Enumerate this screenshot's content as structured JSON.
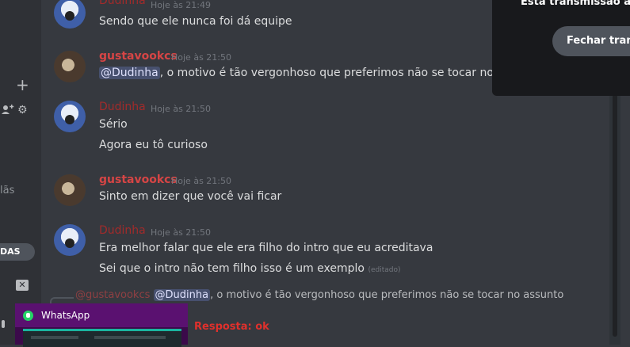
{
  "sidebar": {
    "partial_label": "lãs",
    "pill_label": "DAS"
  },
  "messages": [
    {
      "user": "Dudinha",
      "time": "Hoje às 21:49",
      "lines": [
        "Sendo que ele nunca foi dá equipe"
      ]
    },
    {
      "user": "gustavookcs",
      "time": "Hoje às 21:50",
      "mention": "@Dudinha",
      "lines": [
        ", o motivo é tão vergonhoso que preferimos não se tocar no assunto"
      ]
    },
    {
      "user": "Dudinha",
      "time": "Hoje às 21:50",
      "lines": [
        "Sério",
        "Agora eu tô curioso"
      ]
    },
    {
      "user": "gustavookcs",
      "time": "Hoje às 21:50",
      "lines": [
        "Sinto em dizer que você vai ficar"
      ]
    },
    {
      "user": "Dudinha",
      "time": "Hoje às 21:50",
      "lines": [
        "Era melhor falar que ele era filho do intro que eu acreditava",
        "Sei que o intro não tem filho isso é um exemplo"
      ],
      "edited": "(editado)"
    }
  ],
  "reply": {
    "user": "@gustavookcs",
    "mention": "@Dudinha",
    "text": ", o motivo é tão vergonhoso que preferimos não se tocar no assunto",
    "response": "Resposta: ok"
  },
  "stream_overlay": {
    "title": "Esta transmissão aca",
    "button": "Fechar trans"
  },
  "whatsapp": {
    "label": "WhatsApp"
  }
}
